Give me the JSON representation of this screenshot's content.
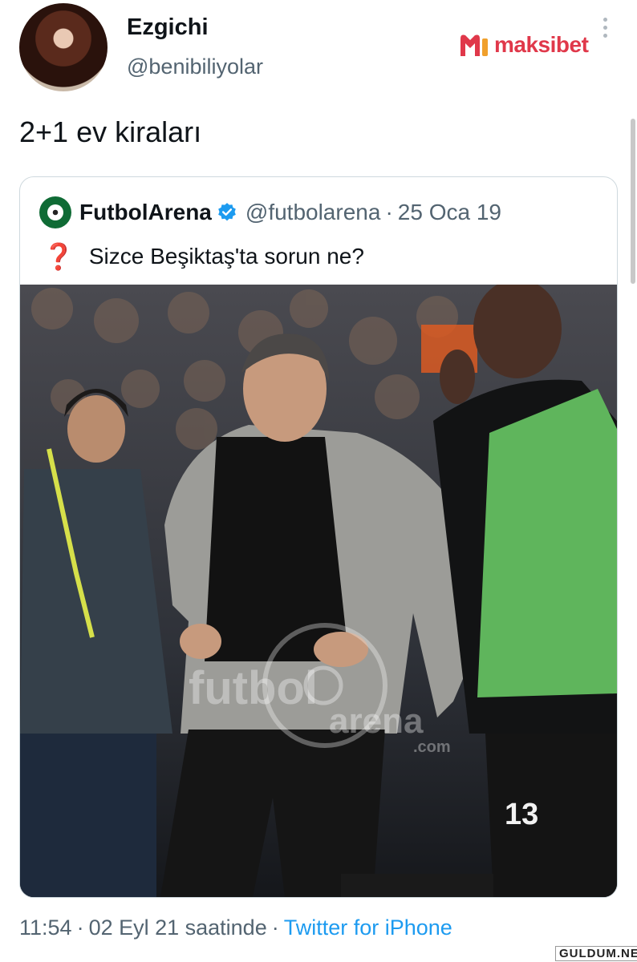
{
  "author": {
    "display_name": "Ezgichi",
    "handle": "@benibiliyolar"
  },
  "ad": {
    "brand": "maksibet",
    "brand_color": "#e0384a"
  },
  "tweet": {
    "text": "2+1 ev kiraları"
  },
  "quote": {
    "name": "FutbolArena",
    "handle": "@futbolarena",
    "dot": "·",
    "date": "25 Oca 19",
    "question_mark": "❓",
    "text": "Sizce Beşiktaş'ta sorun ne?",
    "media": {
      "watermark_line1": "futbol",
      "watermark_line2": "arena",
      "watermark_line3": ".com",
      "jersey_number": "13"
    }
  },
  "footer": {
    "time": "11:54",
    "dot1": "·",
    "date_text": "02 Eyl 21 saatinde",
    "dot2": "·",
    "client": "Twitter for iPhone"
  },
  "site_watermark": "GULDUM.NET",
  "colors": {
    "link": "#1d9bf0",
    "muted": "#536471",
    "verified": "#1d9bf0"
  }
}
